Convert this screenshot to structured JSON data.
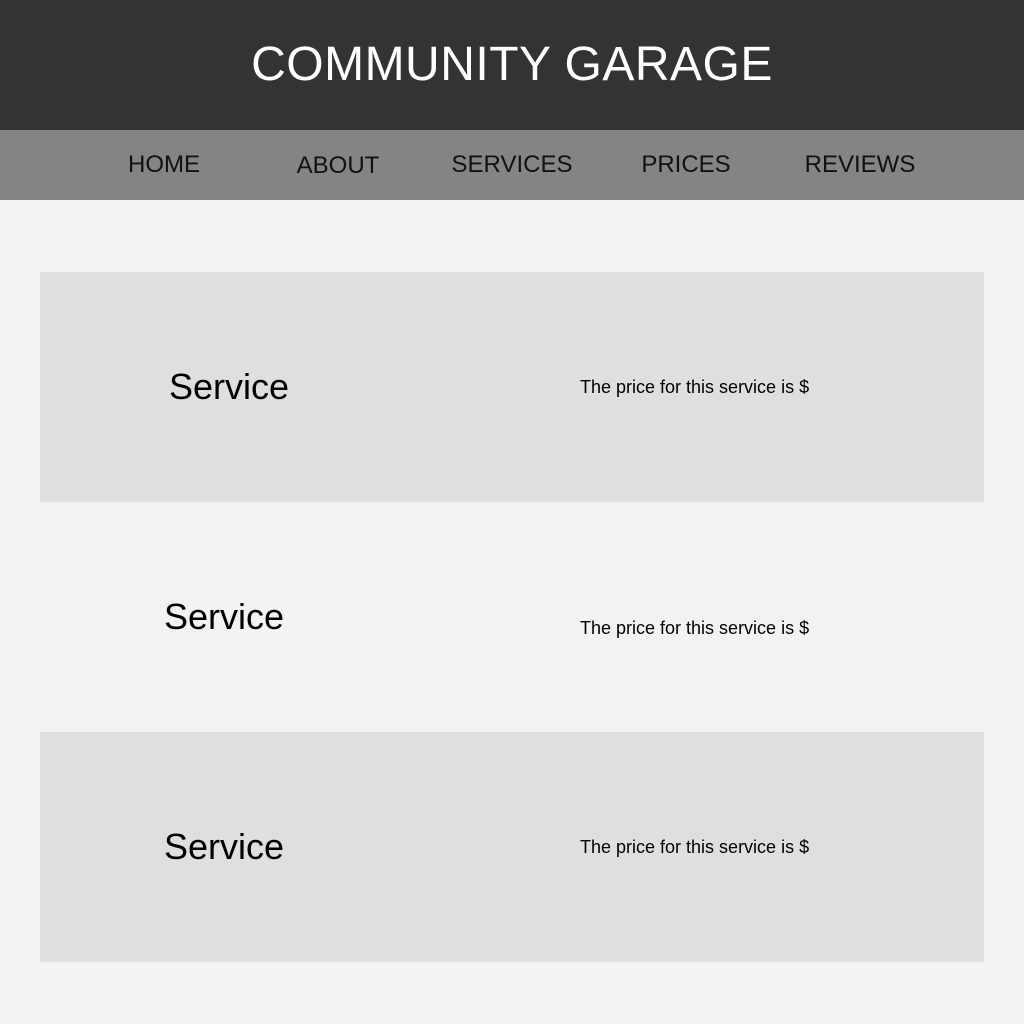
{
  "header": {
    "title": "COMMUNITY GARAGE"
  },
  "nav": {
    "items": [
      {
        "label": "HOME"
      },
      {
        "label": "ABOUT"
      },
      {
        "label": "SERVICES"
      },
      {
        "label": "PRICES"
      },
      {
        "label": "REVIEWS"
      }
    ]
  },
  "services": [
    {
      "name": "Service",
      "price_text": "The price for this service is $"
    },
    {
      "name": "Service",
      "price_text": "The price for this service is $"
    },
    {
      "name": "Service",
      "price_text": "The price for this service is $"
    }
  ],
  "colors": {
    "header_bg": "#333333",
    "nav_bg": "#848484",
    "page_bg": "#f2f2f2",
    "row_shade": "#dfdfdf"
  }
}
